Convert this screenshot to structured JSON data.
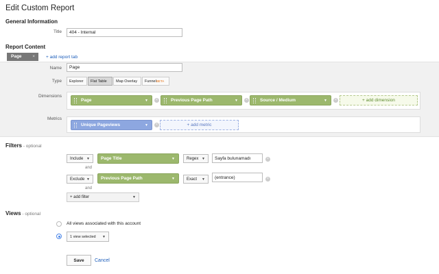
{
  "page_title": "Edit Custom Report",
  "general": {
    "heading": "General Information",
    "title_label": "Title",
    "title_value": "404 - Internal"
  },
  "content": {
    "heading": "Report Content",
    "tab_label": "Page",
    "tab_close": "×",
    "add_tab": "+ add report tab",
    "name_label": "Name",
    "name_value": "Page",
    "type_label": "Type",
    "types": [
      "Explorer",
      "Flat Table",
      "Map Overlay",
      "Funnel"
    ],
    "beta": "BETA",
    "dimensions_label": "Dimensions",
    "dimensions": [
      "Page",
      "Previous Page Path",
      "Source / Medium"
    ],
    "add_dimension": "+ add dimension",
    "metrics_label": "Metrics",
    "metrics": [
      "Unique Pageviews"
    ],
    "add_metric": "+ add metric"
  },
  "filters": {
    "heading": "Filters",
    "optional": " - optional",
    "rows": [
      {
        "mode": "Include",
        "dimension": "Page Title",
        "match": "Regex",
        "value": "Sayfa bulunamadı"
      },
      {
        "mode": "Exclude",
        "dimension": "Previous Page Path",
        "match": "Exact",
        "value": "(entrance)"
      }
    ],
    "and_label": "and",
    "add_filter": "+ add filter"
  },
  "views": {
    "heading": "Views",
    "optional": " - optional",
    "all_views": "All views associated with this account",
    "selected": "1 view selected"
  },
  "actions": {
    "save": "Save",
    "cancel": "Cancel"
  },
  "icons": {
    "caret": "▼",
    "remove": "×"
  }
}
